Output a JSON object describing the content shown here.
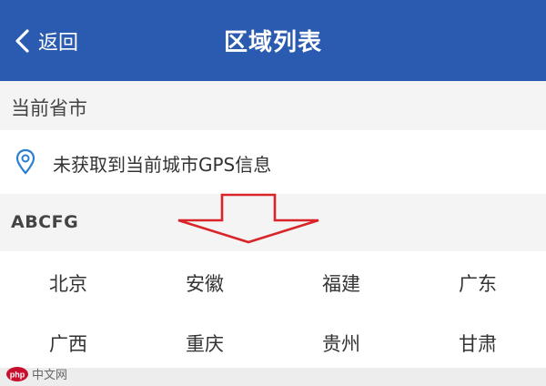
{
  "header": {
    "back_label": "返回",
    "title": "区域列表",
    "color": "#2b5bb0"
  },
  "current_section": {
    "label": "当前省市"
  },
  "gps": {
    "icon": "location-pin-icon",
    "text": "未获取到当前城市GPS信息"
  },
  "group": {
    "label": "ABCFG"
  },
  "annotation": {
    "icon": "down-arrow-icon",
    "color": "#d9252a"
  },
  "provinces": [
    [
      "北京",
      "安徽",
      "福建",
      "广东"
    ],
    [
      "广西",
      "重庆",
      "贵州",
      "甘肃"
    ]
  ],
  "watermark": {
    "logo_text": "php",
    "text": "中文网"
  }
}
